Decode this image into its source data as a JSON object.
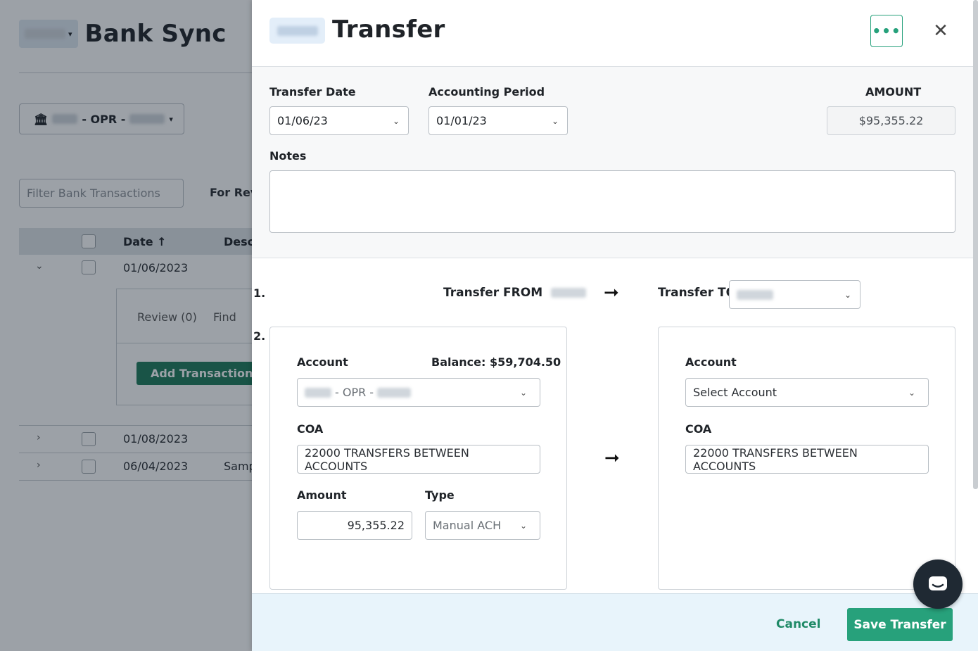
{
  "background": {
    "page_title": "Bank Sync",
    "bank_account_label": "- OPR -",
    "filter_placeholder": "Filter Bank Transactions",
    "for_review_tab": "For Rev",
    "table_headers": {
      "date": "Date",
      "sort_arrow": "↑",
      "description": "Desc"
    },
    "rows": [
      {
        "date": "01/06/2023",
        "description": ""
      },
      {
        "date": "01/08/2023",
        "description": ""
      },
      {
        "date": "06/04/2023",
        "description": "Samp"
      }
    ],
    "subtabs": {
      "review": "Review (0)",
      "find": "Find"
    },
    "add_transaction": "Add Transaction"
  },
  "drawer": {
    "title": "Transfer",
    "more_icon": "•••",
    "close_icon": "✕",
    "transfer_date_label": "Transfer Date",
    "transfer_date_value": "01/06/23",
    "accounting_period_label": "Accounting Period",
    "accounting_period_value": "01/01/23",
    "amount_label": "AMOUNT",
    "amount_value": "$95,355.22",
    "notes_label": "Notes",
    "notes_value": "",
    "step1": "1.",
    "step2": "2.",
    "transfer_from_label": "Transfer FROM",
    "transfer_to_label": "Transfer TO",
    "arrow": "➞",
    "from_card": {
      "account_label": "Account",
      "balance": "Balance: $59,704.50",
      "account_value_mid": "- OPR -",
      "coa_label": "COA",
      "coa_value": "22000 TRANSFERS BETWEEN ACCOUNTS",
      "amount_label": "Amount",
      "amount_value": "95,355.22",
      "type_label": "Type",
      "type_value": "Manual ACH"
    },
    "to_card": {
      "account_label": "Account",
      "account_value": "Select Account",
      "coa_label": "COA",
      "coa_value": "22000 TRANSFERS BETWEEN ACCOUNTS"
    },
    "cancel": "Cancel",
    "save": "Save Transfer"
  },
  "colors": {
    "accent": "#27a17b",
    "footer_bg": "#e8f4fb",
    "overlay": "rgba(20,30,45,0.42)"
  }
}
